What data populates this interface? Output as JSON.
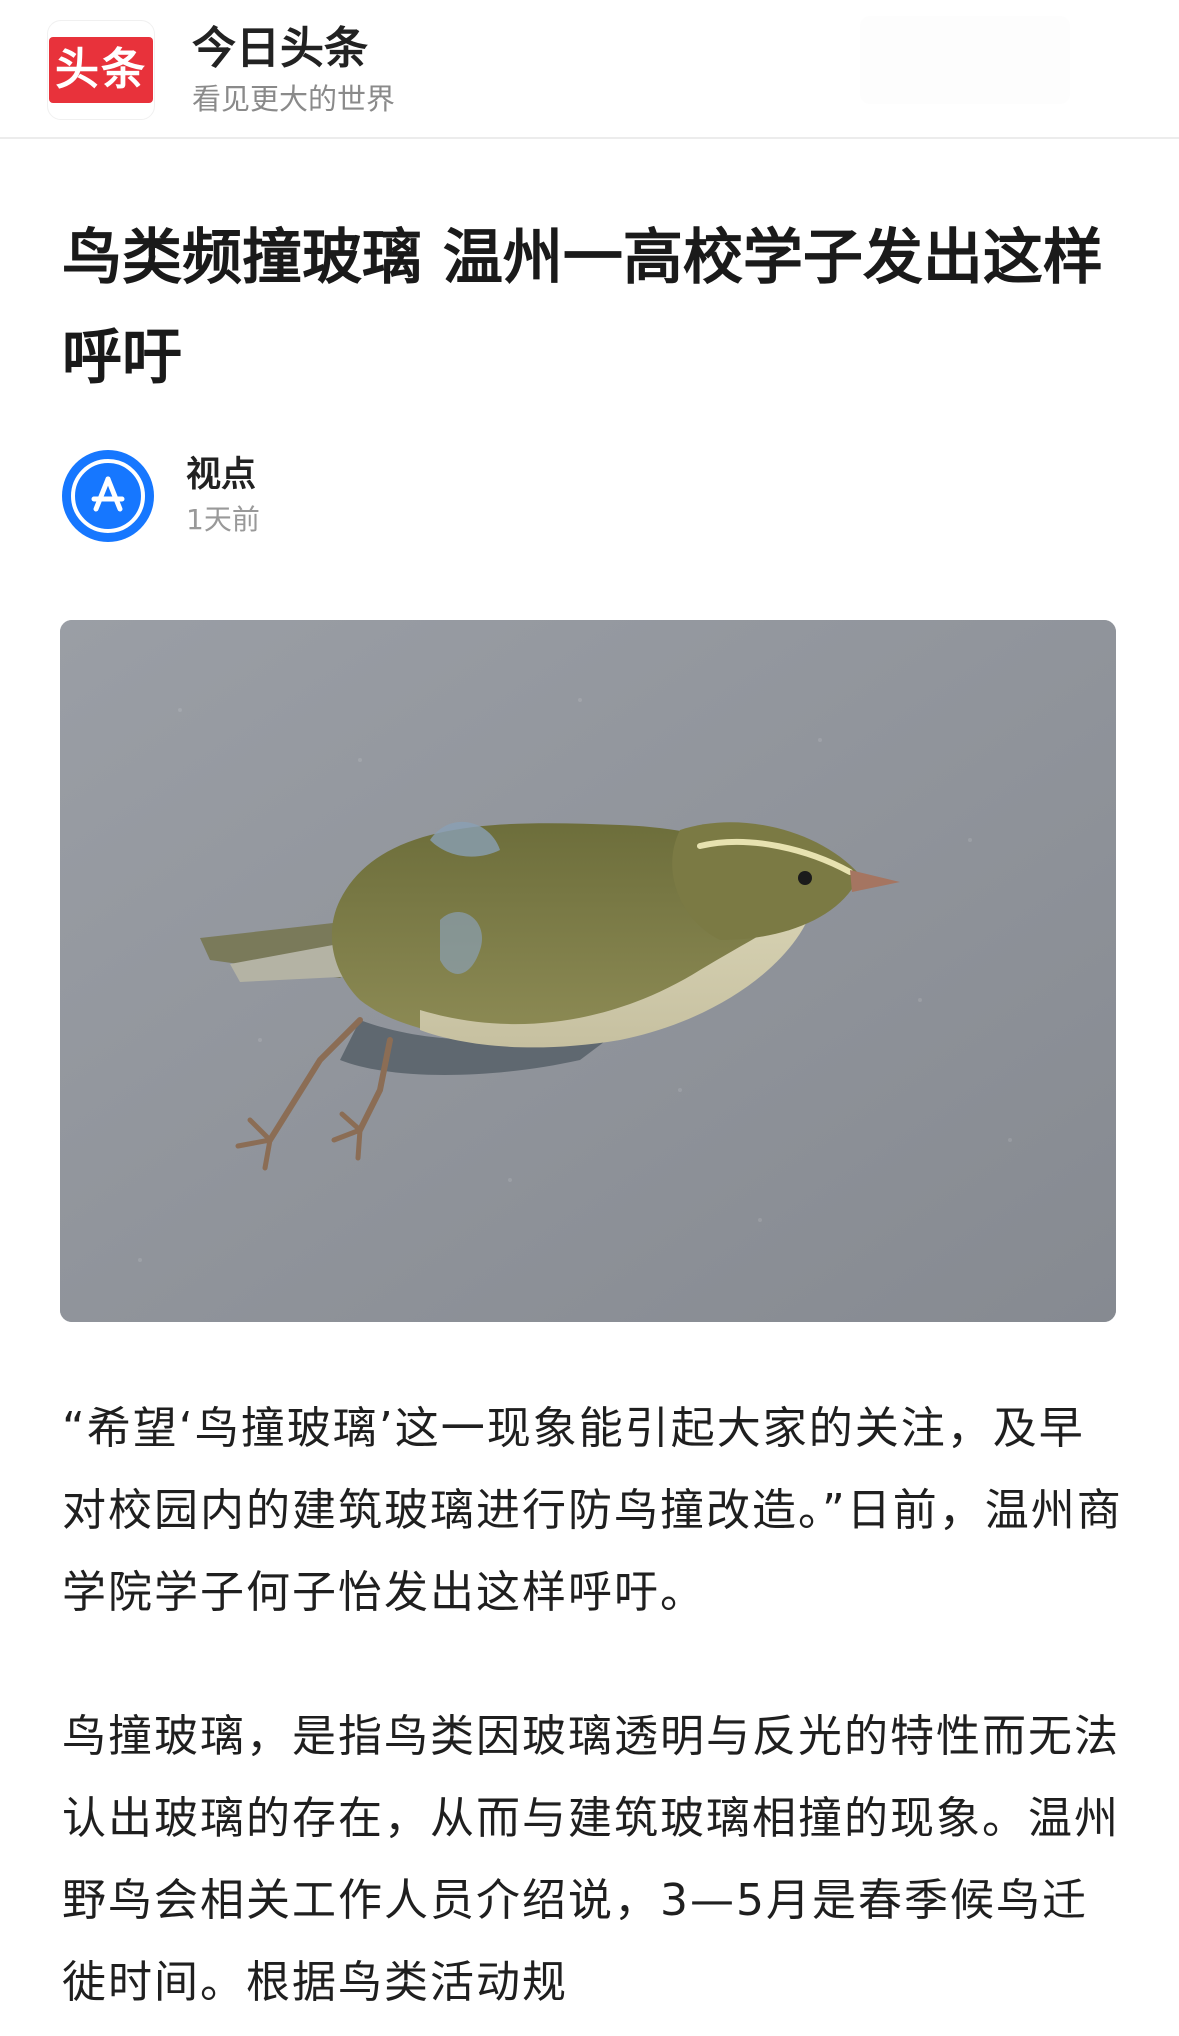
{
  "header": {
    "logo_text": "头条",
    "app_name": "今日头条",
    "slogan": "看见更大的世界"
  },
  "article": {
    "title": "鸟类频撞玻璃 温州一高校学子发出这样呼吁",
    "author": {
      "name": "视点",
      "avatar_icon": "app-store-icon",
      "time": "1天前"
    },
    "hero_image_icon": "bird-photo",
    "paragraphs": [
      "“希望‘鸟撞玻璃’这一现象能引起大家的关注，及早对校园内的建筑玻璃进行防鸟撞改造。”日前，温州商学院学子何子怡发出这样呼吁。",
      "鸟撞玻璃，是指鸟类因玻璃透明与反光的特性而无法认出玻璃的存在，从而与建筑玻璃相撞的现象。温州野鸟会相关工作人员介绍说，3—5月是春季候鸟迁徙时间。根据鸟类活动规"
    ]
  },
  "colors": {
    "brand_red": "#e8323b",
    "avatar_blue": "#1677ff",
    "text_dark": "#1f1f1f",
    "text_gray": "#999999"
  }
}
